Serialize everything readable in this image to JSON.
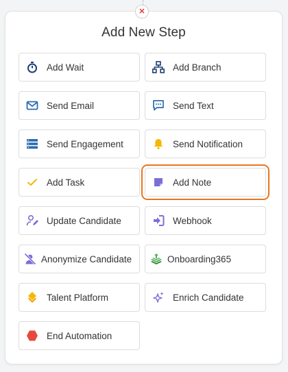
{
  "dialog": {
    "title": "Add New Step",
    "close_symbol": "✕"
  },
  "colors": {
    "accent_blue": "#2b6cb0",
    "highlight_border": "#e8761e",
    "icon_purple": "#7b6fd6"
  },
  "steps": [
    {
      "label": "Add Wait",
      "icon": "stopwatch-icon"
    },
    {
      "label": "Add Branch",
      "icon": "branch-tree-icon"
    },
    {
      "label": "Send Email",
      "icon": "envelope-icon"
    },
    {
      "label": "Send Text",
      "icon": "chat-bubble-icon"
    },
    {
      "label": "Send Engagement",
      "icon": "server-stack-icon"
    },
    {
      "label": "Send Notification",
      "icon": "bell-icon"
    },
    {
      "label": "Add Task",
      "icon": "checkmark-icon"
    },
    {
      "label": "Add Note",
      "icon": "note-icon",
      "highlighted": true
    },
    {
      "label": "Update Candidate",
      "icon": "user-edit-icon"
    },
    {
      "label": "Webhook",
      "icon": "sign-in-arrow-icon"
    },
    {
      "label": "Anonymize Candidate",
      "icon": "user-slash-icon"
    },
    {
      "label": "Onboarding365",
      "icon": "layers-icon"
    },
    {
      "label": "Talent Platform",
      "icon": "diamond-stack-icon"
    },
    {
      "label": "Enrich Candidate",
      "icon": "sparkles-icon"
    },
    {
      "label": "End Automation",
      "icon": "hexagon-icon"
    }
  ]
}
